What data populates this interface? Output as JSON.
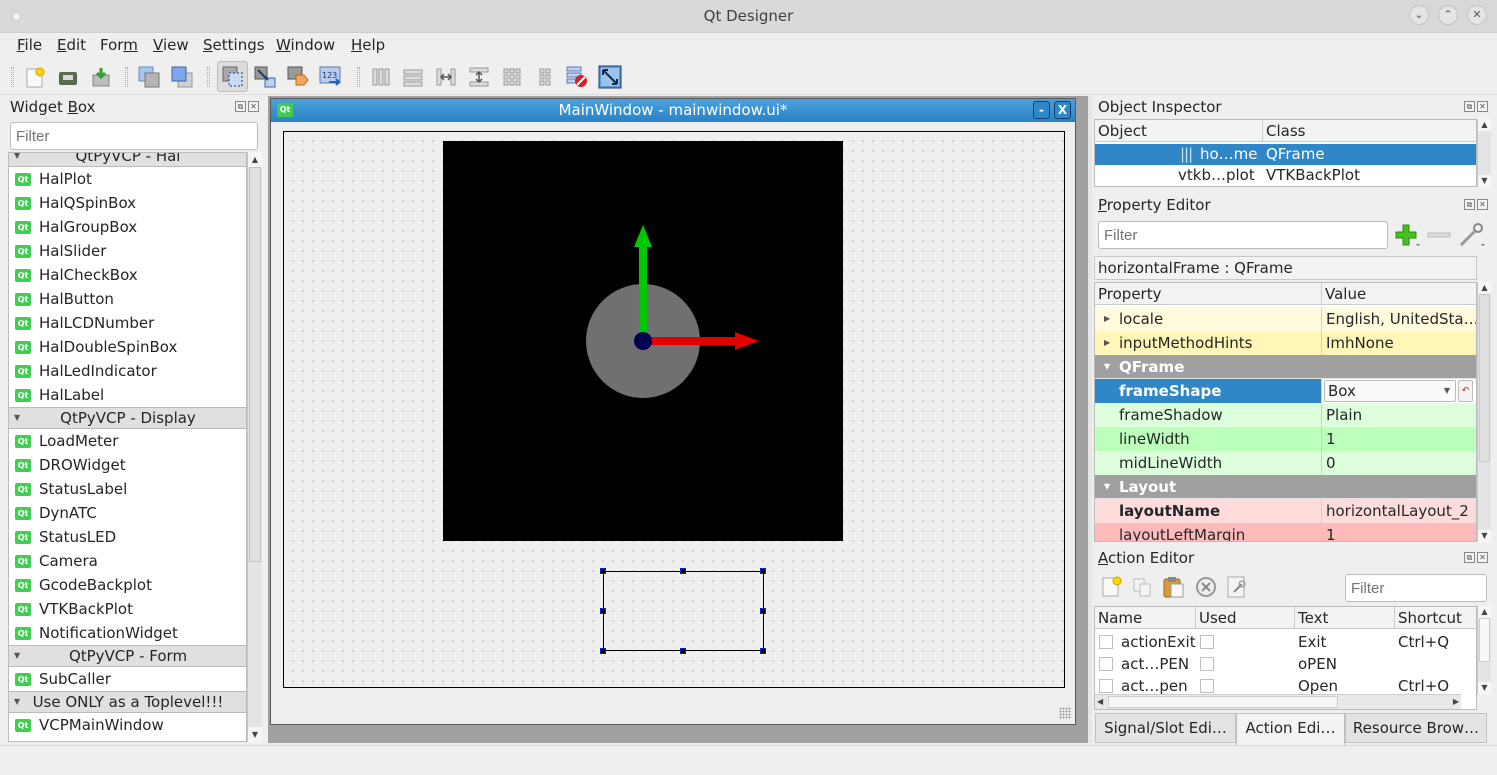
{
  "window": {
    "title": "Qt Designer",
    "controls": [
      "minimize",
      "maximize",
      "close"
    ]
  },
  "menubar": [
    {
      "label": "File",
      "mnemonic": "F",
      "rest": "ile"
    },
    {
      "label": "Edit",
      "mnemonic": "E",
      "rest": "dit"
    },
    {
      "label": "Form",
      "pre": "For",
      "mnemonic": "m",
      "rest": ""
    },
    {
      "label": "View",
      "mnemonic": "V",
      "rest": "iew"
    },
    {
      "label": "Settings",
      "mnemonic": "S",
      "rest": "ettings"
    },
    {
      "label": "Window",
      "mnemonic": "W",
      "rest": "indow"
    },
    {
      "label": "Help",
      "mnemonic": "H",
      "rest": "elp"
    }
  ],
  "toolbar": {
    "file_tools": [
      "new-form-icon",
      "open-form-icon",
      "save-form-icon"
    ],
    "window_tools": [
      "send-to-back-icon",
      "bring-to-front-icon"
    ],
    "mode_tools": [
      "edit-widgets-icon",
      "edit-signals-slots-icon",
      "edit-buddies-icon",
      "edit-tab-order-icon"
    ],
    "active_mode": "edit-widgets-icon",
    "layout_tools": [
      "layout-horizontal-icon",
      "layout-vertical-icon",
      "layout-horizontal-splitter-icon",
      "layout-vertical-splitter-icon",
      "layout-grid-icon",
      "layout-form-icon",
      "break-layout-icon",
      "adjust-size-icon"
    ]
  },
  "widget_box": {
    "title": "Widget Box",
    "title_mnemonic": "B",
    "filter_placeholder": "Filter",
    "categories": [
      {
        "name": "QtPyVCP - Hal",
        "items": [
          "HalPlot",
          "HalQSpinBox",
          "HalGroupBox",
          "HalSlider",
          "HalCheckBox",
          "HalButton",
          "HalLCDNumber",
          "HalDoubleSpinBox",
          "HalLedIndicator",
          "HalLabel"
        ]
      },
      {
        "name": "QtPyVCP - Display",
        "items": [
          "LoadMeter",
          "DROWidget",
          "StatusLabel",
          "DynATC",
          "StatusLED",
          "Camera",
          "GcodeBackplot",
          "VTKBackPlot",
          "NotificationWidget"
        ]
      },
      {
        "name": "QtPyVCP - Form",
        "items": [
          "SubCaller"
        ]
      },
      {
        "name": "Use ONLY as a Toplevel!!!",
        "items": [
          "VCPMainWindow"
        ]
      }
    ]
  },
  "form_window": {
    "title": "MainWindow - mainwindow.ui*",
    "icon": "qt-designer-icon",
    "colors": {
      "title_bar": "#2f87c8",
      "vtk_background": "#000000",
      "x_axis": "#e00000",
      "y_axis": "#00c800",
      "origin": "#000050",
      "tool": "#707070"
    }
  },
  "object_inspector": {
    "title": "Object Inspector",
    "columns": [
      "Object",
      "Class"
    ],
    "rows": [
      {
        "object": "ho…me",
        "class": "QFrame",
        "selected": true,
        "icon": "horizontal-layout-icon"
      },
      {
        "object": "vtkb…plot",
        "class": "VTKBackPlot",
        "selected": false
      }
    ]
  },
  "property_editor": {
    "title": "Property Editor",
    "filter_placeholder": "Filter",
    "object_label": "horizontalFrame : QFrame",
    "columns": [
      "Property",
      "Value"
    ],
    "rows": [
      {
        "type": "prop",
        "name": "locale",
        "value": "English, UnitedSta…",
        "expandable": true,
        "bg": "#fffbdc"
      },
      {
        "type": "prop",
        "name": "inputMethodHints",
        "value": "ImhNone",
        "expandable": true,
        "bg": "#fff6b8"
      },
      {
        "type": "group",
        "name": "QFrame"
      },
      {
        "type": "prop",
        "name": "frameShape",
        "value": "Box",
        "selected": true,
        "bold": true,
        "bg": "#dcffdc"
      },
      {
        "type": "prop",
        "name": "frameShadow",
        "value": "Plain",
        "bg": "#dcffdc"
      },
      {
        "type": "prop",
        "name": "lineWidth",
        "value": "1",
        "bg": "#bbffbb"
      },
      {
        "type": "prop",
        "name": "midLineWidth",
        "value": "0",
        "bg": "#dcffdc"
      },
      {
        "type": "group",
        "name": "Layout"
      },
      {
        "type": "prop",
        "name": "layoutName",
        "value": "horizontalLayout_2",
        "bold": true,
        "bg": "#ffdcdc"
      },
      {
        "type": "prop",
        "name": "layoutLeftMargin",
        "value": "1",
        "bg": "#ffbbbb"
      }
    ]
  },
  "action_editor": {
    "title": "Action Editor",
    "filter_placeholder": "Filter",
    "tools": [
      "new-action-icon",
      "copy-action-icon",
      "paste-action-icon",
      "delete-action-icon",
      "configure-icon"
    ],
    "columns": [
      "Name",
      "Used",
      "Text",
      "Shortcut"
    ],
    "rows": [
      {
        "name": "actionExit",
        "used": false,
        "text": "Exit",
        "shortcut": "Ctrl+Q"
      },
      {
        "name": "act…PEN",
        "used": false,
        "text": "oPEN",
        "shortcut": ""
      },
      {
        "name": "act…pen",
        "used": false,
        "text": "Open",
        "shortcut": "Ctrl+O"
      }
    ]
  },
  "bottom_tabs": [
    {
      "label": "Signal/Slot Edi…",
      "selected": false
    },
    {
      "label": "Action Edi…",
      "selected": true
    },
    {
      "label": "Resource Brow…",
      "selected": false
    }
  ]
}
